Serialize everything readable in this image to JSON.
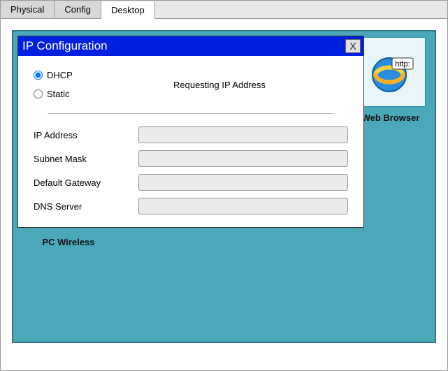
{
  "tabs": {
    "physical": "Physical",
    "config": "Config",
    "desktop": "Desktop"
  },
  "dialog": {
    "title": "IP Configuration",
    "close": "X",
    "mode": {
      "dhcp": "DHCP",
      "static": "Static",
      "selected": "dhcp"
    },
    "status": "Requesting IP Address",
    "fields": {
      "ip_label": "IP Address",
      "ip_value": "",
      "subnet_label": "Subnet Mask",
      "subnet_value": "",
      "gateway_label": "Default Gateway",
      "gateway_value": "",
      "dns_label": "DNS Server",
      "dns_value": ""
    }
  },
  "desktop_icons": {
    "web_browser": "Web Browser",
    "pc_wireless": "PC Wireless",
    "browser_badge": "http:"
  }
}
